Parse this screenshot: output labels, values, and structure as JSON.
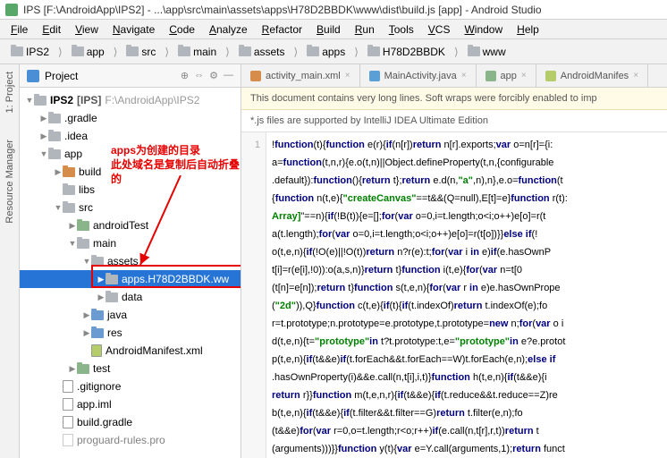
{
  "titlebar": {
    "text": "IPS [F:\\AndroidApp\\IPS2] - ...\\app\\src\\main\\assets\\apps\\H78D2BBDK\\www\\dist\\build.js [app] - Android Studio"
  },
  "menu": [
    "File",
    "Edit",
    "View",
    "Navigate",
    "Code",
    "Analyze",
    "Refactor",
    "Build",
    "Run",
    "Tools",
    "VCS",
    "Window",
    "Help"
  ],
  "breadcrumbs": [
    "IPS2",
    "app",
    "src",
    "main",
    "assets",
    "apps",
    "H78D2BBDK",
    "www"
  ],
  "panel": {
    "title": "Project"
  },
  "sideTabs": {
    "project": "1: Project",
    "resmgr": "Resource Manager"
  },
  "tree": {
    "root": "IPS2",
    "root_tag": "[IPS]",
    "root_path": "F:\\AndroidApp\\IPS2",
    "gradle": ".gradle",
    "idea": ".idea",
    "app": "app",
    "build": "build",
    "libs": "libs",
    "src": "src",
    "androidTest": "androidTest",
    "main": "main",
    "assets": "assets",
    "selected": "apps.H78D2BBDK.ww",
    "data": "data",
    "java": "java",
    "res": "res",
    "manifest": "AndroidManifest.xml",
    "test": "test",
    "gitignore": ".gitignore",
    "appiml": "app.iml",
    "buildgradle": "build.gradle",
    "proguard": "proguard-rules.pro"
  },
  "annotation": {
    "line1": "apps为创建的目录",
    "line2": "此处域名是复制后自动折叠的"
  },
  "tabs": [
    {
      "label": "activity_main.xml",
      "icon": "ic-xml"
    },
    {
      "label": "MainActivity.java",
      "icon": "ic-java"
    },
    {
      "label": "app",
      "icon": "ic-mod"
    },
    {
      "label": "AndroidManifes",
      "icon": "ic-mf"
    }
  ],
  "banner1": "This document contains very long lines. Soft wraps were forcibly enabled to imp",
  "banner2": "*.js files are supported by IntelliJ IDEA Ultimate Edition",
  "code": [
    "!function(t){function e(r){if(n[r])return n[r].exports;var o=n[r]={i:",
    "a=function(t,n,r){e.o(t,n)||Object.defineProperty(t,n,{configurable",
    ".default}):function(){return t};return e.d(n,\"a\",n),n},e.o=function(t",
    "{function n(t,e){\"createCanvas\"==t&&(Q=null),E[t]=e}function r(t):",
    "Array]\"==n){if(!B(t)){e=[];for(var o=0,i=t.length;o<i;o++)e[o]=r(t",
    "a(t.length);for(var o=0,i=t.length;o<i;o++)e[o]=r(t[o])}}else if(!",
    "o(t,e,n){if(!O(e)||!O(t))return n?r(e):t;for(var i in e)if(e.hasOwnP",
    "t[i]=r(e[i],!0)):o(a,s,n)}return t}function i(t,e){for(var n=t[0",
    "(t[n]=e[n]);return t}function s(t,e,n){for(var r in e)e.hasOwnPrope",
    "(\"2d\")),Q}function c(t,e){if(t){if(t.indexOf)return t.indexOf(e);fo",
    "r=t.prototype;n.prototype=e.prototype,t.prototype=new n;for(var o i",
    "d(t,e,n){t=\"prototype\"in t?t.prototype:t,e=\"prototype\"in e?e.protot",
    "p(t,e,n){if(t&&e)if(t.forEach&&t.forEach==W)t.forEach(e,n);else if",
    ".hasOwnProperty(i)&&e.call(n,t[i],i,t)}function h(t,e,n){if(t&&e){i",
    "return r}}function m(t,e,n,r){if(t&&e){if(t.reduce&&t.reduce==Z)re",
    "b(t,e,n){if(t&&e){if(t.filter&&t.filter==G)return t.filter(e,n);fo",
    "(t&&e)for(var r=0,o=t.length;r<o;r++)if(e.call(n,t[r],r,t))return t",
    "(arguments)))}}function y(t){var e=Y.call(arguments,1);return funct"
  ]
}
